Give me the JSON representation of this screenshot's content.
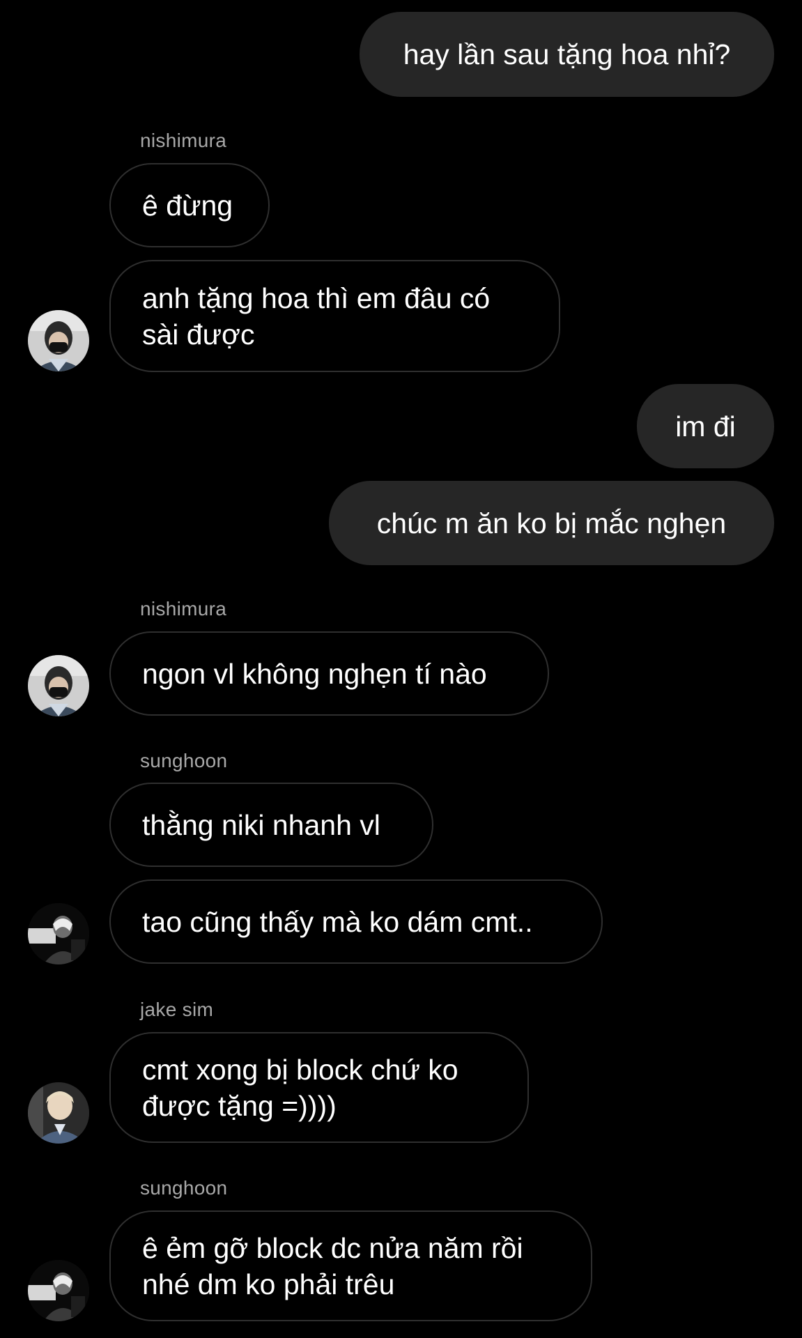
{
  "messages": [
    {
      "text": "hay lần sau tặng hoa nhỉ?"
    },
    {
      "sender": "nishimura",
      "text": "ê đừng"
    },
    {
      "text": "anh tặng hoa thì em đâu có sài được"
    },
    {
      "text": "im đi"
    },
    {
      "text": "chúc m ăn ko bị mắc nghẹn"
    },
    {
      "sender": "nishimura",
      "text": "ngon vl không nghẹn tí nào"
    },
    {
      "sender": "sunghoon",
      "text": "thằng niki nhanh vl"
    },
    {
      "text": "tao cũng thấy mà ko dám cmt.."
    },
    {
      "sender": "jake sim",
      "text": "cmt xong bị block chứ ko được tặng =))))"
    },
    {
      "sender": "sunghoon",
      "text": "ê ẻm gỡ block dc nửa năm rồi nhé dm ko phải trêu"
    }
  ],
  "avatars": [
    {
      "icon": "avatar-nishimura-icon"
    },
    {
      "icon": "avatar-nishimura-icon"
    },
    {
      "icon": "avatar-sunghoon-icon"
    },
    {
      "icon": "avatar-jake-sim-icon"
    },
    {
      "icon": "avatar-sunghoon-icon"
    }
  ],
  "colors": {
    "background": "#000000",
    "outgoing_bubble": "#262626",
    "incoming_border": "#2f2f2f",
    "sender_name": "#a8a8a8",
    "text": "#ffffff"
  }
}
